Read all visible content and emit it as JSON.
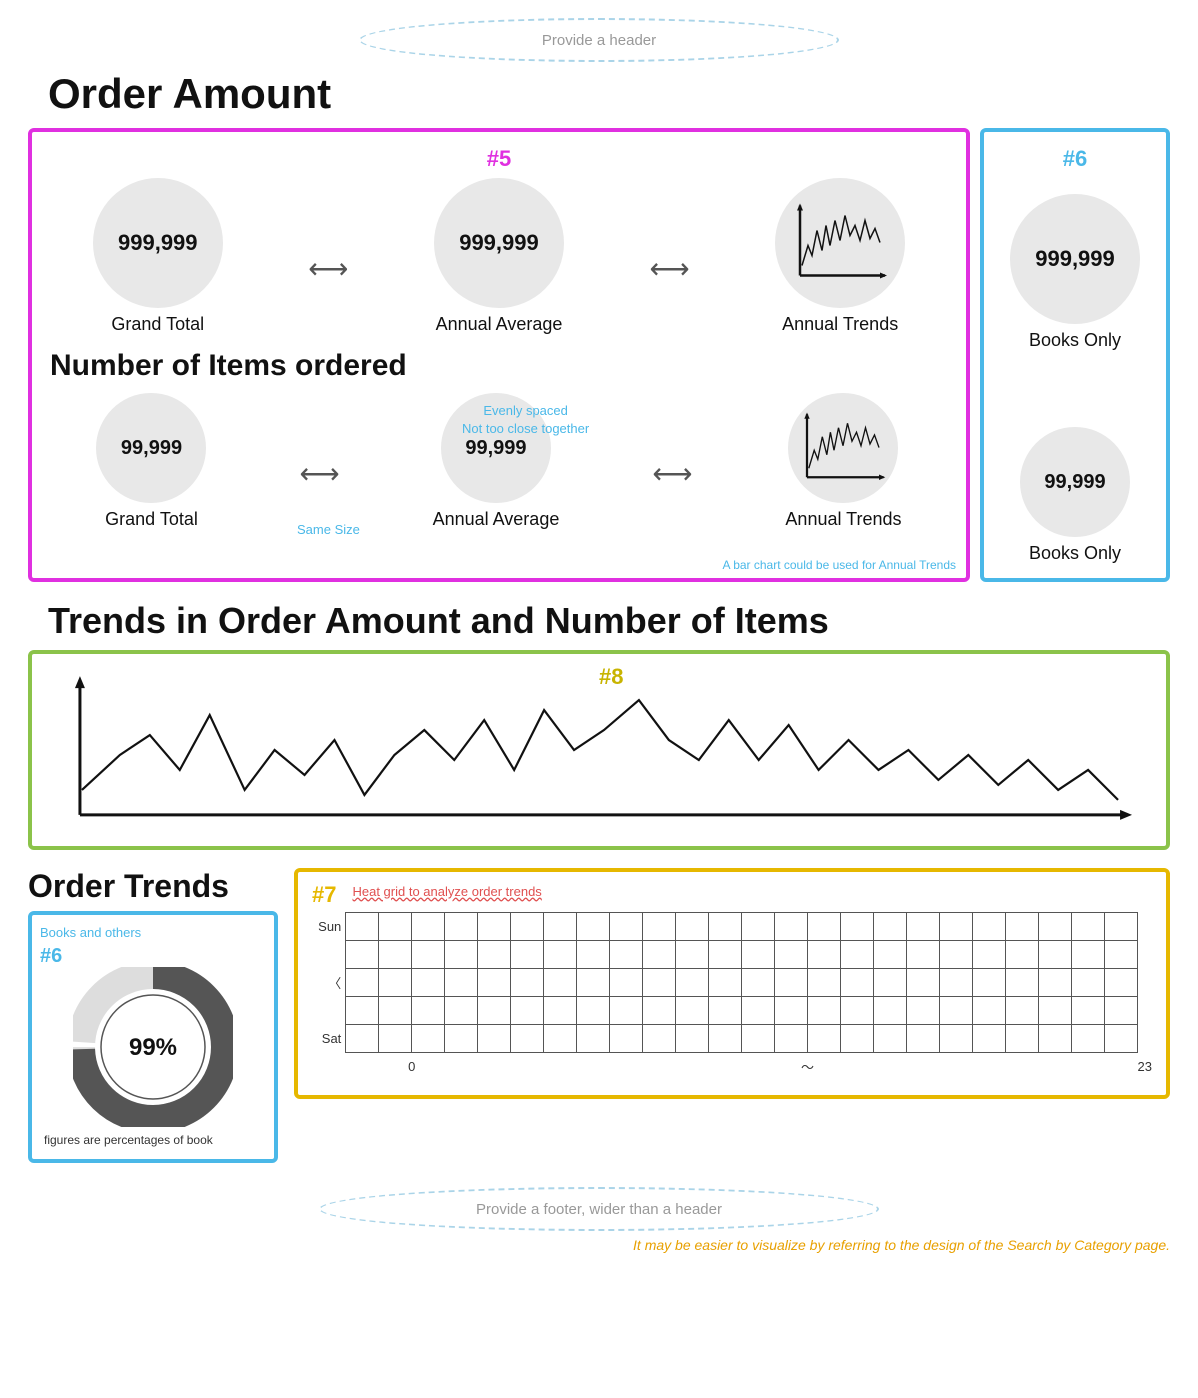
{
  "header": {
    "oval_text": "Provide a header",
    "page_title": "Order Amount"
  },
  "section5": {
    "number": "#5",
    "rows": [
      {
        "items": [
          {
            "value": "999,999",
            "label": "Grand Total"
          },
          {
            "value": "999,999",
            "label": "Annual Average"
          },
          {
            "value": "chart",
            "label": "Annual Trends"
          }
        ]
      },
      {
        "items": [
          {
            "value": "99,999",
            "label": "Grand Total"
          },
          {
            "value": "99,999",
            "label": "Annual Average"
          },
          {
            "value": "chart",
            "label": "Annual Trends"
          }
        ]
      }
    ],
    "sub_title": "Number of Items ordered",
    "annotations": {
      "evenly_spaced": "Evenly spaced",
      "not_too_close": "Not too close together",
      "same_size": "Same Size",
      "bar_chart_note": "A bar chart could be used for Annual Trends"
    }
  },
  "section6_top": {
    "number": "#6",
    "items": [
      {
        "value": "999,999",
        "label": "Books Only"
      },
      {
        "value": "99,999",
        "label": "Books Only"
      }
    ]
  },
  "trends_section": {
    "title": "Trends in Order Amount and Number of Items",
    "number": "#8"
  },
  "order_trends": {
    "title": "Order Trends",
    "section6_number": "#6",
    "annotation_books": "Books and others",
    "donut_value": "99%",
    "footer_note": "figures are percentages of book"
  },
  "heatgrid": {
    "number": "#7",
    "annotation": "Heat grid to analyze order trends",
    "rows": [
      "Sun",
      "",
      "〈",
      "",
      "Sat"
    ],
    "col_start": "0",
    "col_mid": "～",
    "col_end": "23"
  },
  "footer": {
    "oval_text": "Provide a footer, wider than a header",
    "note": "It may be easier to visualize by referring to the design of the Search by Category page."
  }
}
